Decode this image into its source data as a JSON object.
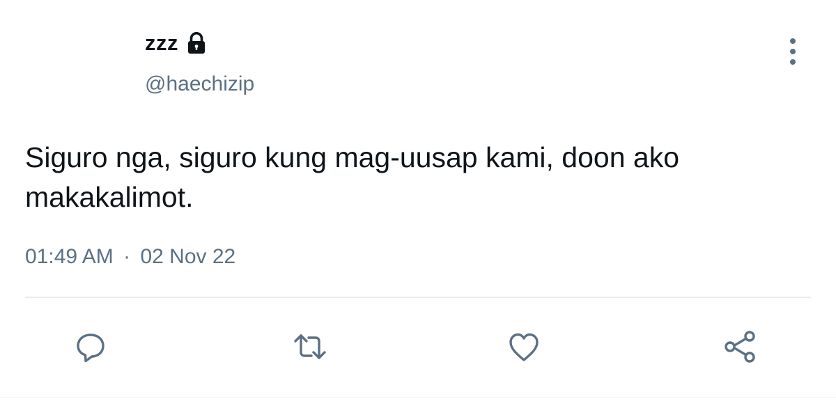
{
  "author": {
    "display_name": "zzz",
    "handle": "@haechizip",
    "protected": true
  },
  "tweet": {
    "text": "Siguro nga, siguro kung mag-uusap kami, doon ako makakalimot.",
    "time": "01:49 AM",
    "separator": "·",
    "date": "02 Nov 22"
  },
  "actions": [
    {
      "name": "reply",
      "icon": "reply-icon"
    },
    {
      "name": "retweet",
      "icon": "retweet-icon"
    },
    {
      "name": "like",
      "icon": "heart-icon"
    },
    {
      "name": "share",
      "icon": "share-icon"
    }
  ],
  "colors": {
    "text_primary": "#0f1419",
    "text_secondary": "#5b7083",
    "icon": "#5b7083",
    "divider": "#e6ecf0"
  }
}
